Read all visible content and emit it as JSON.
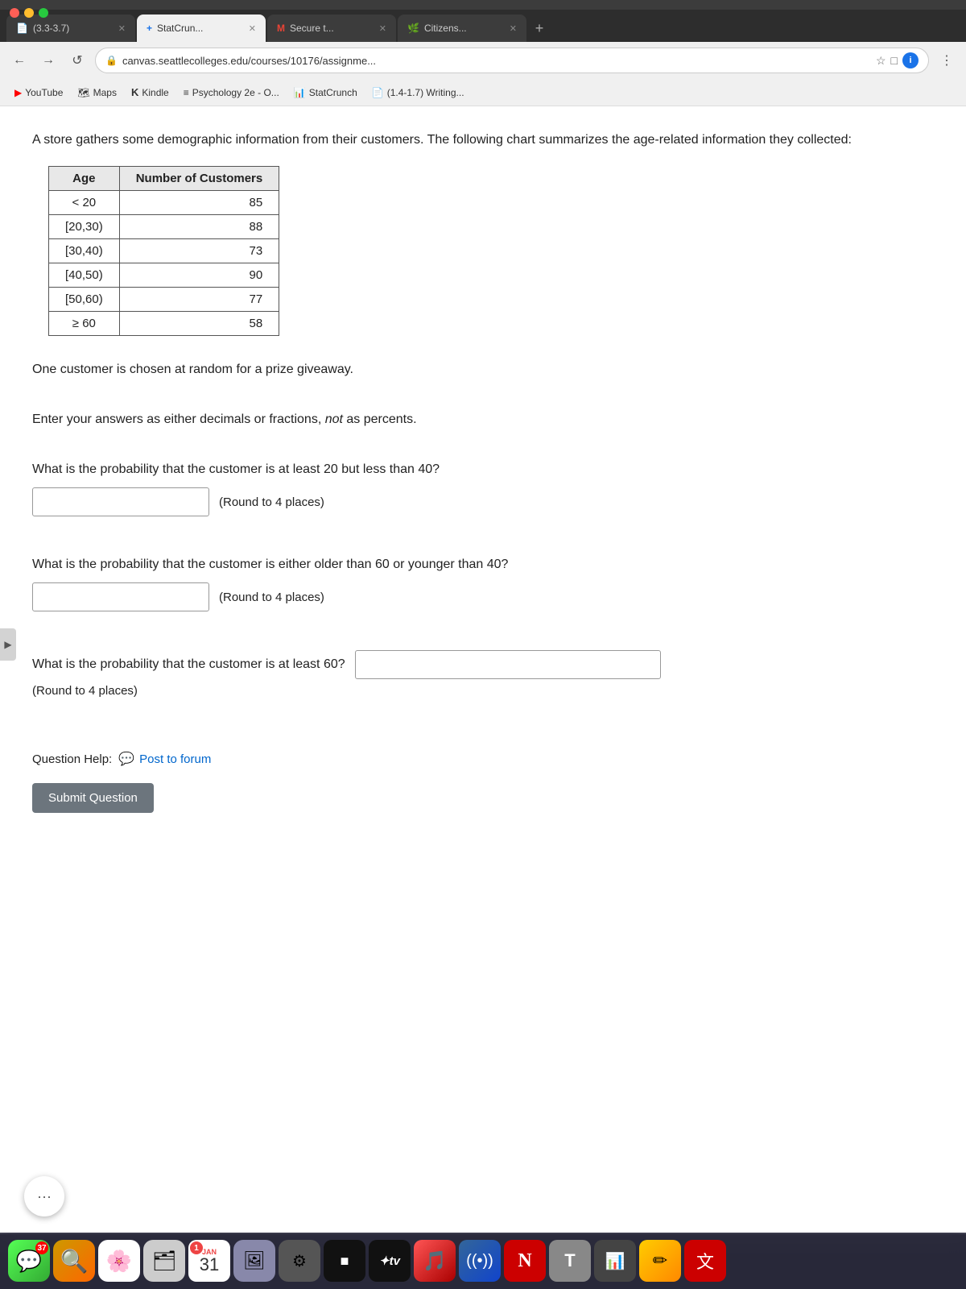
{
  "browser": {
    "tabs": [
      {
        "id": "tab1",
        "label": "(3.3-3.7)",
        "favicon": "📄",
        "active": false
      },
      {
        "id": "tab2",
        "label": "StatCrun...",
        "favicon": "➕",
        "active": true
      },
      {
        "id": "tab3",
        "label": "Secure t...",
        "favicon": "M",
        "active": false
      },
      {
        "id": "tab4",
        "label": "Citizens...",
        "favicon": "🌿",
        "active": false
      }
    ],
    "address": "canvas.seattlecolleges.edu/courses/10176/assignme...",
    "bookmarks": [
      {
        "id": "bm1",
        "label": "YouTube",
        "icon": "▶"
      },
      {
        "id": "bm2",
        "label": "Maps",
        "icon": "🗺"
      },
      {
        "id": "bm3",
        "label": "Kindle",
        "icon": "K"
      },
      {
        "id": "bm4",
        "label": "Psychology 2e - O...",
        "icon": "≡"
      },
      {
        "id": "bm5",
        "label": "StatCrunch",
        "icon": "📊"
      },
      {
        "id": "bm6",
        "label": "(1.4-1.7) Writing...",
        "icon": "📄"
      }
    ]
  },
  "page": {
    "intro": "A store gathers some demographic information from their customers. The following chart summarizes the age-related information they collected:",
    "table": {
      "headers": [
        "Age",
        "Number of Customers"
      ],
      "rows": [
        {
          "age": "< 20",
          "count": "85"
        },
        {
          "age": "[20,30)",
          "count": "88"
        },
        {
          "age": "[30,40)",
          "count": "73"
        },
        {
          "age": "[40,50)",
          "count": "90"
        },
        {
          "age": "[50,60)",
          "count": "77"
        },
        {
          "age": "≥ 60",
          "count": "58"
        }
      ]
    },
    "random_note": "One customer is chosen at random for a prize giveaway.",
    "decimal_note": "Enter your answers as either decimals or fractions, not as percents.",
    "q1": {
      "text": "What is the probability that the customer is at least 20 but less than 40?",
      "round_note": "(Round to 4 places)"
    },
    "q2": {
      "text": "What is the probability that the customer is either older than 60 or younger than 40?",
      "round_note": "(Round to 4 places)"
    },
    "q3": {
      "text": "What is the probability that the customer is at least 60?",
      "round_note": "(Round to 4 places)"
    },
    "question_help_label": "Question Help:",
    "post_to_forum": "Post to forum",
    "submit_button": "Submit Question"
  },
  "chat": {
    "icon": "···"
  },
  "taskbar": {
    "apps": [
      {
        "id": "app-messages",
        "emoji": "💬",
        "badge": "37",
        "bg": "#3c3"
      },
      {
        "id": "app-finder",
        "emoji": "🔍",
        "bg": "#fa0"
      },
      {
        "id": "app-photos",
        "emoji": "🌸",
        "bg": "#fff"
      },
      {
        "id": "app-finder2",
        "emoji": "🗂",
        "bg": "#999"
      },
      {
        "id": "app-calendar",
        "type": "date",
        "month": "JAN",
        "day": "31",
        "badge": "1"
      },
      {
        "id": "app-something",
        "emoji": "🖼",
        "bg": "#88f"
      },
      {
        "id": "app-dots",
        "emoji": "⚙",
        "bg": "#555"
      },
      {
        "id": "app-black",
        "emoji": "⬛",
        "bg": "#111"
      },
      {
        "id": "app-tv",
        "label": "tv",
        "emoji": "📺",
        "bg": "#111"
      },
      {
        "id": "app-music",
        "emoji": "🎵",
        "bg": "#f55"
      },
      {
        "id": "app-wifi",
        "emoji": "📶",
        "bg": "#36c"
      },
      {
        "id": "app-n",
        "emoji": "N",
        "bg": "#c00"
      },
      {
        "id": "app-t",
        "emoji": "T",
        "bg": "#888"
      },
      {
        "id": "app-bar",
        "emoji": "📊",
        "bg": "#555"
      },
      {
        "id": "app-edit",
        "emoji": "✏",
        "bg": "#fc0"
      },
      {
        "id": "app-kanji",
        "emoji": "文",
        "bg": "#c00"
      }
    ]
  }
}
